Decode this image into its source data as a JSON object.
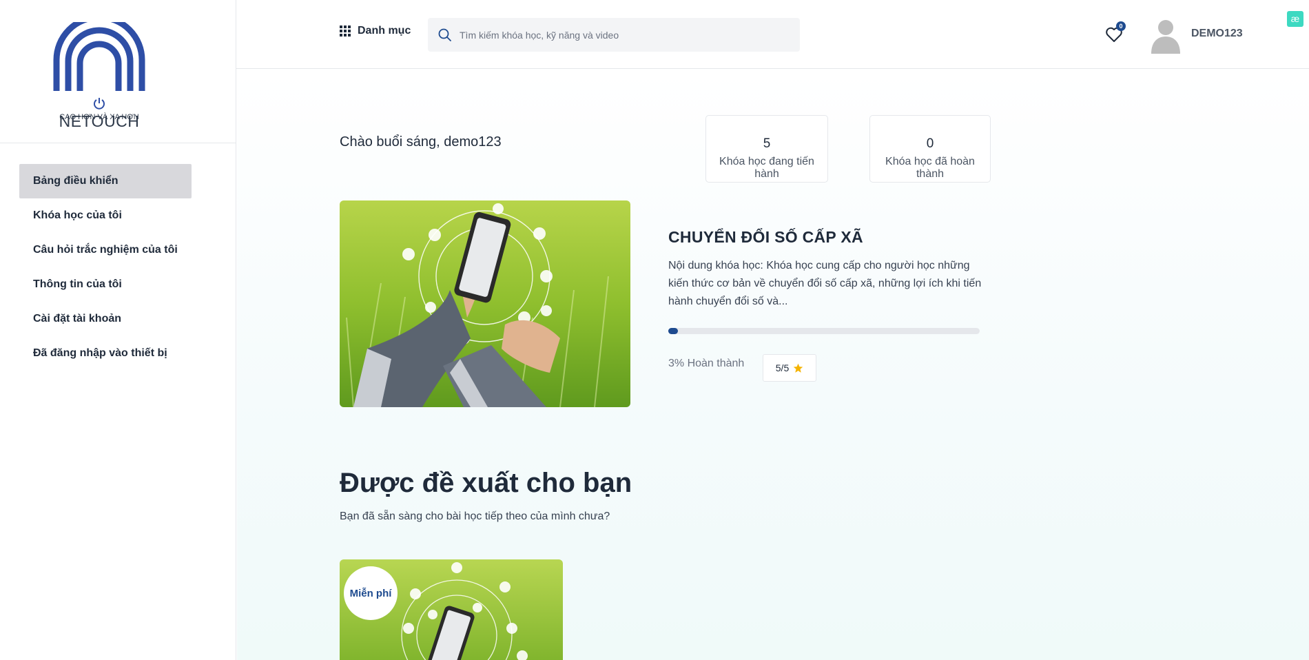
{
  "brand": {
    "logo_text": "NETOUCH",
    "tagline": "CAO HƠN VÀ XA HƠN",
    "colors": {
      "primary": "#1e4b8f",
      "logo_blue": "#2e4ea6",
      "accent_teal": "#3dd9c1",
      "star": "#f5b301"
    }
  },
  "sidebar": {
    "items": [
      {
        "label": "Bảng điều khiển",
        "active": true
      },
      {
        "label": "Khóa học của tôi",
        "active": false
      },
      {
        "label": "Câu hỏi trắc nghiệm của tôi",
        "active": false
      },
      {
        "label": "Thông tin của tôi",
        "active": false
      },
      {
        "label": "Cài đặt tài khoản",
        "active": false
      },
      {
        "label": "Đã đăng nhập vào thiết bị",
        "active": false
      }
    ]
  },
  "header": {
    "category_label": "Danh mục",
    "search_placeholder": "Tìm kiếm khóa học, kỹ năng và video",
    "wishlist_count": "0",
    "username": "DEMO123",
    "extension_icon": "æ"
  },
  "dashboard": {
    "greeting": "Chào buổi sáng, demo123",
    "stats": [
      {
        "value": "5",
        "label": "Khóa học đang tiến hành"
      },
      {
        "value": "0",
        "label": "Khóa học đã hoàn thành"
      }
    ],
    "current_course": {
      "title": "CHUYỂN ĐỔI SỐ CẤP XÃ",
      "description": "Nội dung khóa học: Khóa học cung cấp cho người học những kiến thức cơ bản về chuyển đổi số cấp xã, những lợi ích khi tiến hành chuyển đổi số và...",
      "progress_percent": 3,
      "progress_text": "3% Hoàn thành",
      "rating": "5/5"
    }
  },
  "recommendations": {
    "title": "Được đề xuất cho bạn",
    "subtitle": "Bạn đã sẵn sàng cho bài học tiếp theo của mình chưa?",
    "cards": [
      {
        "badge": "Miễn phí"
      }
    ]
  }
}
